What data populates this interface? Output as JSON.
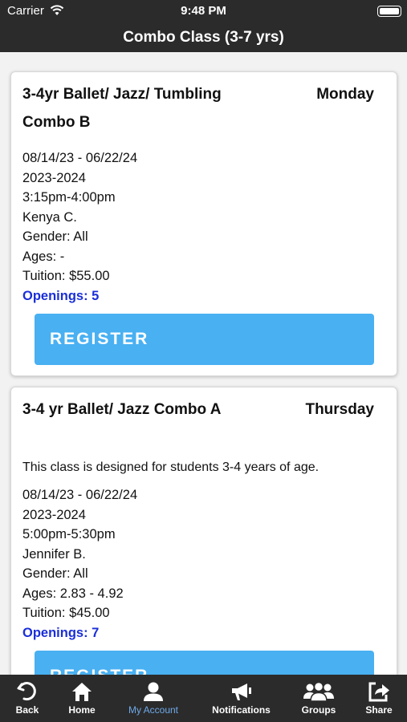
{
  "status_bar": {
    "carrier": "Carrier",
    "time": "9:48 PM"
  },
  "nav": {
    "title": "Combo Class (3-7 yrs)"
  },
  "classes": [
    {
      "title": "3-4yr Ballet/ Jazz/ Tumbling Combo B",
      "day": "Monday",
      "description": "",
      "dates": "08/14/23 - 06/22/24",
      "season": "2023-2024",
      "time": "3:15pm-4:00pm",
      "instructor": "Kenya C.",
      "gender": "Gender: All",
      "ages": "Ages: -",
      "tuition": "Tuition: $55.00",
      "openings": "Openings: 5",
      "button_label": "REGISTER"
    },
    {
      "title": "3-4 yr Ballet/ Jazz Combo A",
      "day": "Thursday",
      "description": "This class is designed for students 3-4 years of age.",
      "dates": "08/14/23 - 06/22/24",
      "season": "2023-2024",
      "time": "5:00pm-5:30pm",
      "instructor": "Jennifer B.",
      "gender": "Gender: All",
      "ages": "Ages: 2.83 - 4.92",
      "tuition": "Tuition: $45.00",
      "openings": "Openings: 7",
      "button_label": "REGISTER"
    }
  ],
  "tabs": [
    {
      "label": "Back",
      "icon": "back-icon"
    },
    {
      "label": "Home",
      "icon": "home-icon"
    },
    {
      "label": "My Account",
      "icon": "user-icon",
      "active": true
    },
    {
      "label": "Notifications",
      "icon": "megaphone-icon"
    },
    {
      "label": "Groups",
      "icon": "groups-icon"
    },
    {
      "label": "Share",
      "icon": "share-icon"
    }
  ],
  "colors": {
    "bars": "#2b2b2b",
    "register_button": "#49b0f2",
    "openings": "#1a2fd8",
    "active_tab": "#6ea9e8"
  }
}
